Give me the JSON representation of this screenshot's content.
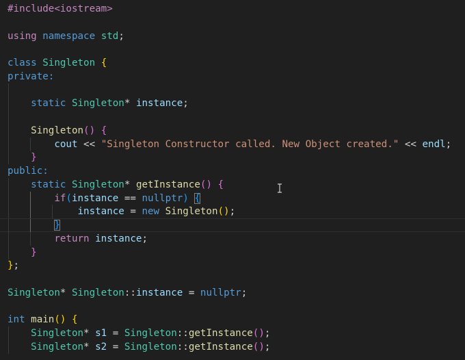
{
  "editor": {
    "language": "cpp",
    "colors": {
      "background": "#1f1f1f",
      "preprocessor": "#c586c0",
      "keyword": "#569cd6",
      "control": "#c586c0",
      "type": "#4ec9b0",
      "function": "#dcdcaa",
      "variable": "#9cdcfe",
      "string": "#ce9178",
      "operator": "#d4d4d4",
      "bracket_gold": "#ffd700",
      "bracket_purple": "#da70d6",
      "bracket_blue": "#179fff"
    },
    "cursor_icon": "text-cursor-icon",
    "lines": [
      {
        "indent": 0,
        "tokens": [
          {
            "t": "#include<iostream>",
            "c": "preprocessor"
          }
        ]
      },
      {
        "indent": 0,
        "tokens": []
      },
      {
        "indent": 0,
        "tokens": [
          {
            "t": "using",
            "c": "control"
          },
          {
            "t": " "
          },
          {
            "t": "namespace",
            "c": "keyword"
          },
          {
            "t": " "
          },
          {
            "t": "std",
            "c": "type"
          },
          {
            "t": ";"
          }
        ]
      },
      {
        "indent": 0,
        "tokens": []
      },
      {
        "indent": 0,
        "tokens": [
          {
            "t": "class",
            "c": "keyword"
          },
          {
            "t": " "
          },
          {
            "t": "Singleton",
            "c": "type"
          },
          {
            "t": " "
          },
          {
            "t": "{",
            "c": "bracket_gold"
          }
        ]
      },
      {
        "indent": 0,
        "tokens": [
          {
            "t": "private:",
            "c": "keyword"
          }
        ]
      },
      {
        "indent": 1,
        "tokens": []
      },
      {
        "indent": 1,
        "tokens": [
          {
            "t": "    "
          },
          {
            "t": "static",
            "c": "keyword"
          },
          {
            "t": " "
          },
          {
            "t": "Singleton",
            "c": "type"
          },
          {
            "t": "* "
          },
          {
            "t": "instance",
            "c": "variable"
          },
          {
            "t": ";"
          }
        ]
      },
      {
        "indent": 1,
        "tokens": []
      },
      {
        "indent": 1,
        "tokens": [
          {
            "t": "    "
          },
          {
            "t": "Singleton",
            "c": "function"
          },
          {
            "t": "()",
            "c": "bracket_purple"
          },
          {
            "t": " "
          },
          {
            "t": "{",
            "c": "bracket_purple"
          }
        ]
      },
      {
        "indent": 2,
        "tokens": [
          {
            "t": "        "
          },
          {
            "t": "cout",
            "c": "variable"
          },
          {
            "t": " << "
          },
          {
            "t": "\"Singleton Constructor called. New Object created.\"",
            "c": "string"
          },
          {
            "t": " << "
          },
          {
            "t": "endl",
            "c": "variable"
          },
          {
            "t": ";"
          }
        ]
      },
      {
        "indent": 1,
        "tokens": [
          {
            "t": "    "
          },
          {
            "t": "}",
            "c": "bracket_purple"
          }
        ]
      },
      {
        "indent": 0,
        "tokens": [
          {
            "t": "public:",
            "c": "keyword"
          }
        ]
      },
      {
        "indent": 1,
        "tokens": [
          {
            "t": "    "
          },
          {
            "t": "static",
            "c": "keyword"
          },
          {
            "t": " "
          },
          {
            "t": "Singleton",
            "c": "type"
          },
          {
            "t": "* "
          },
          {
            "t": "getInstance",
            "c": "function"
          },
          {
            "t": "()",
            "c": "bracket_purple"
          },
          {
            "t": " "
          },
          {
            "t": "{",
            "c": "bracket_purple"
          }
        ]
      },
      {
        "indent": 2,
        "tokens": [
          {
            "t": "        "
          },
          {
            "t": "if",
            "c": "control"
          },
          {
            "t": "(",
            "c": "bracket_blue"
          },
          {
            "t": "instance",
            "c": "variable"
          },
          {
            "t": " == "
          },
          {
            "t": "nullptr",
            "c": "keyword"
          },
          {
            "t": ")",
            "c": "bracket_blue"
          },
          {
            "t": " "
          },
          {
            "t": "{",
            "c": "bracket_blue",
            "match": true
          }
        ]
      },
      {
        "indent": 3,
        "tokens": [
          {
            "t": "            "
          },
          {
            "t": "instance",
            "c": "variable"
          },
          {
            "t": " = "
          },
          {
            "t": "new",
            "c": "keyword"
          },
          {
            "t": " "
          },
          {
            "t": "Singleton",
            "c": "function"
          },
          {
            "t": "()",
            "c": "bracket_gold"
          },
          {
            "t": ";"
          }
        ]
      },
      {
        "indent": 2,
        "current": true,
        "tokens": [
          {
            "t": "        "
          },
          {
            "t": "}",
            "c": "bracket_blue",
            "match": true
          }
        ]
      },
      {
        "indent": 2,
        "tokens": [
          {
            "t": "        "
          },
          {
            "t": "return",
            "c": "control"
          },
          {
            "t": " "
          },
          {
            "t": "instance",
            "c": "variable"
          },
          {
            "t": ";"
          }
        ]
      },
      {
        "indent": 1,
        "tokens": [
          {
            "t": "    "
          },
          {
            "t": "}",
            "c": "bracket_purple"
          }
        ]
      },
      {
        "indent": 0,
        "tokens": [
          {
            "t": "}",
            "c": "bracket_gold"
          },
          {
            "t": ";"
          }
        ]
      },
      {
        "indent": 0,
        "tokens": []
      },
      {
        "indent": 0,
        "tokens": [
          {
            "t": "Singleton",
            "c": "type"
          },
          {
            "t": "* "
          },
          {
            "t": "Singleton",
            "c": "type"
          },
          {
            "t": "::"
          },
          {
            "t": "instance",
            "c": "variable"
          },
          {
            "t": " = "
          },
          {
            "t": "nullptr",
            "c": "keyword"
          },
          {
            "t": ";"
          }
        ]
      },
      {
        "indent": 0,
        "tokens": []
      },
      {
        "indent": 0,
        "tokens": [
          {
            "t": "int",
            "c": "keyword"
          },
          {
            "t": " "
          },
          {
            "t": "main",
            "c": "function"
          },
          {
            "t": "()",
            "c": "bracket_gold"
          },
          {
            "t": " "
          },
          {
            "t": "{",
            "c": "bracket_gold"
          }
        ]
      },
      {
        "indent": 1,
        "tokens": [
          {
            "t": "    "
          },
          {
            "t": "Singleton",
            "c": "type"
          },
          {
            "t": "* "
          },
          {
            "t": "s1",
            "c": "variable"
          },
          {
            "t": " = "
          },
          {
            "t": "Singleton",
            "c": "type"
          },
          {
            "t": "::"
          },
          {
            "t": "getInstance",
            "c": "function"
          },
          {
            "t": "()",
            "c": "bracket_purple"
          },
          {
            "t": ";"
          }
        ]
      },
      {
        "indent": 1,
        "tokens": [
          {
            "t": "    "
          },
          {
            "t": "Singleton",
            "c": "type"
          },
          {
            "t": "* "
          },
          {
            "t": "s2",
            "c": "variable"
          },
          {
            "t": " = "
          },
          {
            "t": "Singleton",
            "c": "type"
          },
          {
            "t": "::"
          },
          {
            "t": "getInstance",
            "c": "function"
          },
          {
            "t": "()",
            "c": "bracket_purple"
          },
          {
            "t": ";"
          }
        ]
      }
    ]
  }
}
